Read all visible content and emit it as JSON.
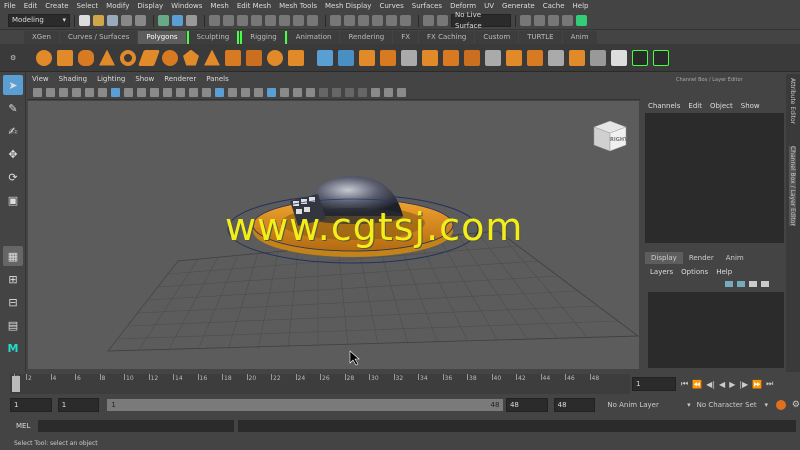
{
  "menubar": [
    "File",
    "Edit",
    "Create",
    "Select",
    "Modify",
    "Display",
    "Windows",
    "Mesh",
    "Edit Mesh",
    "Mesh Tools",
    "Mesh Display",
    "Curves",
    "Surfaces",
    "Deform",
    "UV",
    "Generate",
    "Cache",
    "Help"
  ],
  "status": {
    "mode": "Modeling",
    "live_surface": "No Live Surface"
  },
  "shelf_tabs": [
    "XGen",
    "Curves / Surfaces",
    "Polygons",
    "Sculpting",
    "Rigging",
    "Animation",
    "Rendering",
    "FX",
    "FX Caching",
    "Custom",
    "TURTLE",
    "Anim"
  ],
  "viewport_menu": [
    "View",
    "Shading",
    "Lighting",
    "Show",
    "Renderer",
    "Panels"
  ],
  "viewcube_label": "RIGHT",
  "channel_box": {
    "header": "Channel Box / Layer Editor",
    "menu": [
      "Channels",
      "Edit",
      "Object",
      "Show"
    ]
  },
  "layer_editor": {
    "tabs": [
      "Display",
      "Render",
      "Anim"
    ],
    "menu": [
      "Layers",
      "Options",
      "Help"
    ]
  },
  "side_tabs": {
    "attribute": "Attribute Editor",
    "channel": "Channel Box / Layer Editor"
  },
  "timeline": {
    "ticks": [
      "1",
      "2",
      "4",
      "6",
      "8",
      "10",
      "12",
      "14",
      "16",
      "18",
      "20",
      "22",
      "24",
      "26",
      "28",
      "30",
      "32",
      "34",
      "36",
      "38",
      "40",
      "42",
      "44",
      "46",
      "48"
    ],
    "current_frame": "1"
  },
  "range": {
    "start": "1",
    "playback_start": "1",
    "slider_start": "1",
    "slider_end": "48",
    "playback_end": "48",
    "end": "48",
    "anim_layer": "No Anim Layer",
    "char_set": "No Character Set"
  },
  "command_line": {
    "label": "MEL"
  },
  "help_line": "Select Tool: select an object",
  "watermark": "www.cgtsj.com",
  "colors": {
    "bg": "#444444",
    "viewport": "#5c5c5c",
    "accent_green": "#44ff44",
    "watermark": "#f3ee18"
  }
}
